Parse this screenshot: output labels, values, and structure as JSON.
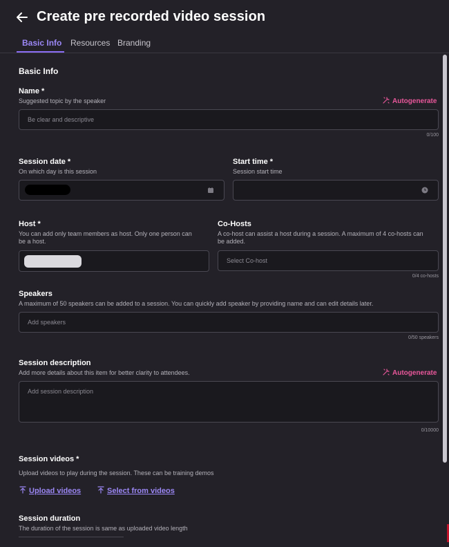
{
  "header": {
    "title": "Create pre recorded video session",
    "back_icon": "arrow-left-icon"
  },
  "tabs": [
    {
      "label": "Basic Info",
      "active": true
    },
    {
      "label": "Resources",
      "active": false
    },
    {
      "label": "Branding",
      "active": false
    }
  ],
  "form": {
    "section_title": "Basic Info",
    "autogenerate_label": "Autogenerate",
    "name": {
      "label": "Name *",
      "help": "Suggested topic by the speaker",
      "placeholder": "Be clear and descriptive",
      "counter": "0/100"
    },
    "session_date": {
      "label": "Session date *",
      "help": "On which day is this session"
    },
    "start_time": {
      "label": "Start time *",
      "help": "Session start time"
    },
    "host": {
      "label": "Host *",
      "help_line1": "You can add only team members as host. Only one person can",
      "help_line2": "be a host."
    },
    "co_hosts": {
      "label": "Co-Hosts",
      "help_line1": "A co-host can assist a host during a session. A maximum of 4 co-hosts can",
      "help_line2": "be added.",
      "placeholder": "Select Co-host",
      "counter": "0/4 co-hosts"
    },
    "speakers": {
      "label": "Speakers",
      "help": "A maximum of 50 speakers can be added to a session. You can quickly add speaker by providing name and can edit details later.",
      "placeholder": "Add speakers",
      "counter": "0/50 speakers"
    },
    "description": {
      "label": "Session description",
      "help": "Add more details about this item for better clarity to attendees.",
      "placeholder": "Add session description",
      "counter": "0/10000"
    },
    "videos": {
      "label": "Session videos *",
      "help": "Upload videos to play during the session. These can be training demos",
      "upload_label": "Upload videos",
      "select_label": "Select from videos"
    },
    "duration": {
      "label": "Session duration",
      "help": "The duration of the session is same as uploaded video length"
    }
  },
  "colors": {
    "background": "#232128",
    "accent": "#9b87f5",
    "autogenerate": "#e8579a",
    "input_bg": "#1a191e"
  }
}
